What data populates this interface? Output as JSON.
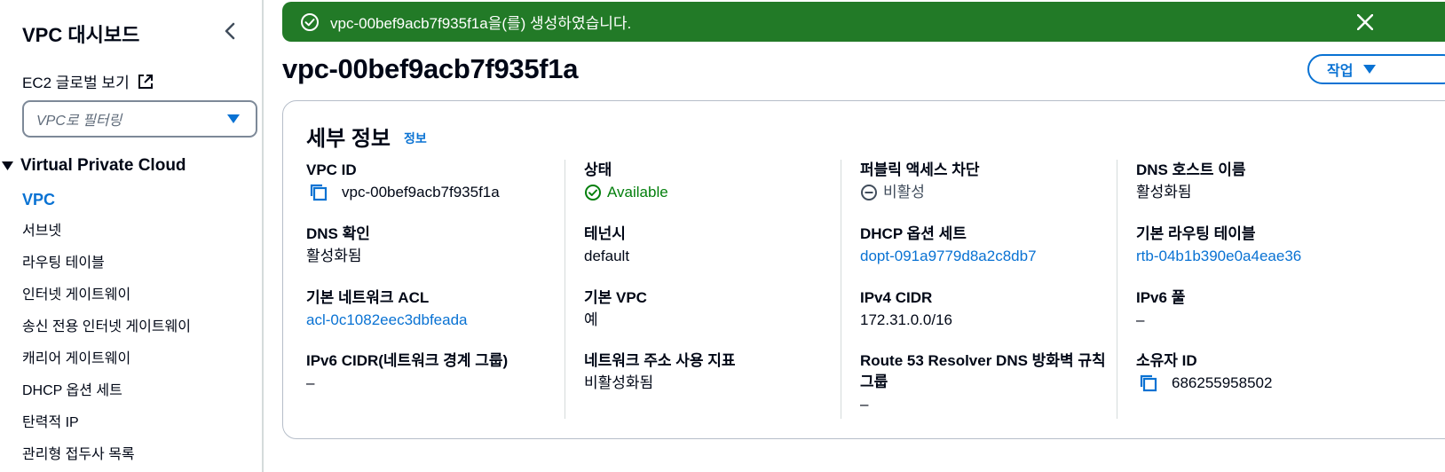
{
  "sidebar": {
    "title": "VPC 대시보드",
    "ec2_global_view": "EC2 글로벌 보기",
    "filter_placeholder": "VPC로 필터링",
    "section": "Virtual Private Cloud",
    "items": [
      {
        "label": "VPC",
        "active": true
      },
      {
        "label": "서브넷"
      },
      {
        "label": "라우팅 테이블"
      },
      {
        "label": "인터넷 게이트웨이"
      },
      {
        "label": "송신 전용 인터넷 게이트웨이"
      },
      {
        "label": "캐리어 게이트웨이"
      },
      {
        "label": "DHCP 옵션 세트"
      },
      {
        "label": "탄력적 IP"
      },
      {
        "label": "관리형 접두사 목록"
      }
    ]
  },
  "flash": {
    "message": "vpc-00bef9acb7f935f1a을(를) 생성하였습니다.",
    "color": "#227a27"
  },
  "header": {
    "title": "vpc-00bef9acb7f935f1a",
    "actions_label": "작업"
  },
  "details": {
    "title": "세부 정보",
    "info_link": "정보",
    "fields": {
      "vpc_id": {
        "label": "VPC ID",
        "value": "vpc-00bef9acb7f935f1a"
      },
      "state": {
        "label": "상태",
        "value": "Available"
      },
      "block_public_access": {
        "label": "퍼블릭 액세스 차단",
        "value": "비활성"
      },
      "dns_hostnames": {
        "label": "DNS 호스트 이름",
        "value": "활성화됨"
      },
      "dns_resolution": {
        "label": "DNS 확인",
        "value": "활성화됨"
      },
      "tenancy": {
        "label": "테넌시",
        "value": "default"
      },
      "dhcp_options": {
        "label": "DHCP 옵션 세트",
        "value": "dopt-091a9779d8a2c8db7"
      },
      "main_route_table": {
        "label": "기본 라우팅 테이블",
        "value": "rtb-04b1b390e0a4eae36"
      },
      "main_network_acl": {
        "label": "기본 네트워크 ACL",
        "value": "acl-0c1082eec3dbfeada"
      },
      "default_vpc": {
        "label": "기본 VPC",
        "value": "예"
      },
      "ipv4_cidr": {
        "label": "IPv4 CIDR",
        "value": "172.31.0.0/16"
      },
      "ipv6_pool": {
        "label": "IPv6 풀",
        "value": "–"
      },
      "ipv6_cidr": {
        "label": "IPv6 CIDR(네트워크 경계 그룹)",
        "value": "–"
      },
      "network_address_metrics": {
        "label": "네트워크 주소 사용 지표",
        "value": "비활성화됨"
      },
      "route53_firewall": {
        "label": "Route 53 Resolver DNS 방화벽 규칙 그룹",
        "value": "–"
      },
      "owner_id": {
        "label": "소유자 ID",
        "value": "686255958502"
      }
    }
  },
  "colors": {
    "link": "#0972d3",
    "success": "#037f0c",
    "text": "#000716"
  }
}
